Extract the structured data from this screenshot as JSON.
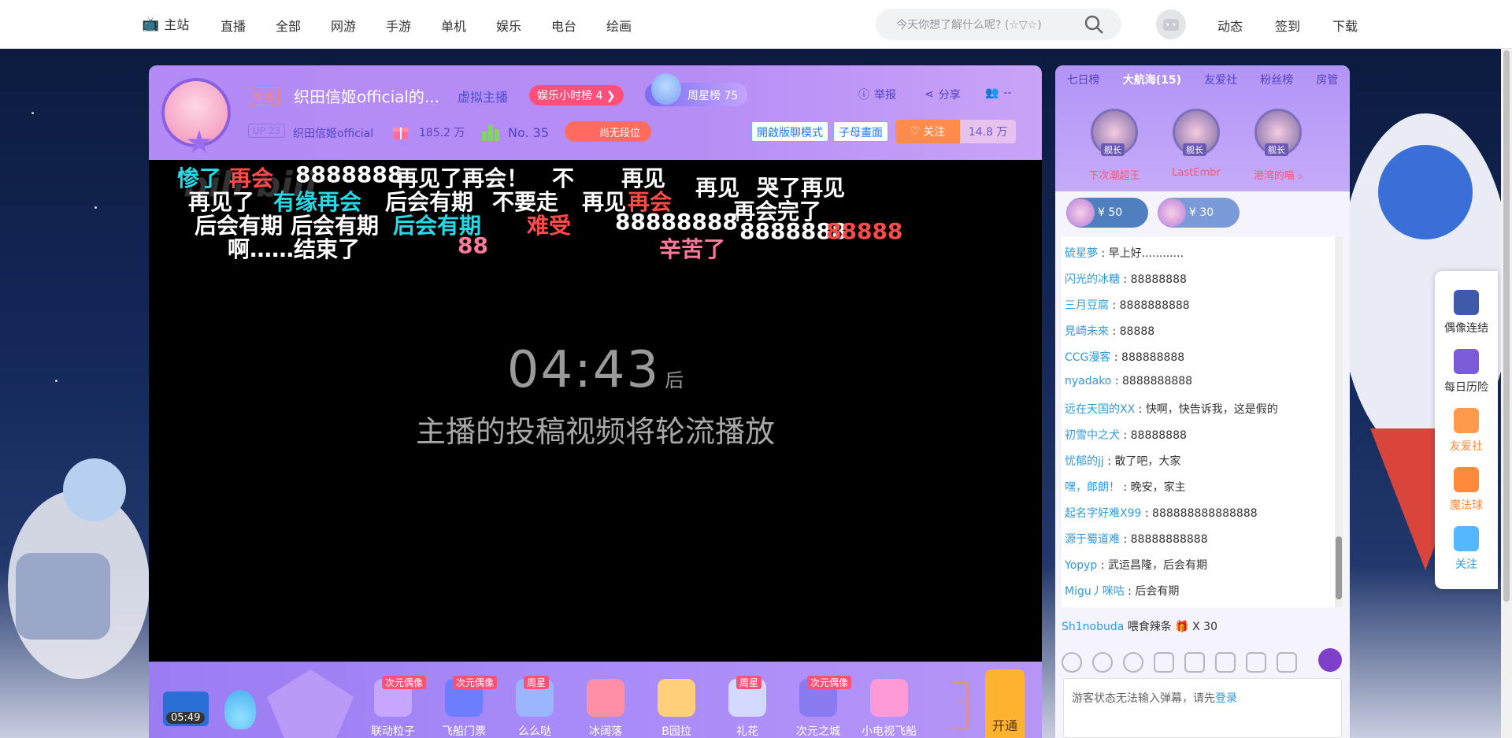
{
  "nav": {
    "home": "主站",
    "links": [
      "直播",
      "全部",
      "网游",
      "手游",
      "单机",
      "娱乐",
      "电台",
      "绘画"
    ],
    "search_placeholder": "今天你想了解什么呢? (☆▽☆)",
    "right_links": [
      "动态",
      "签到",
      "下载"
    ]
  },
  "room": {
    "live_badge": "轮播",
    "title": "织田信姬official的...",
    "category": "虚拟主播",
    "hour_rank": "娱乐小时榜 4",
    "week_rank": "周星榜 75",
    "report": "举报",
    "share": "分享",
    "viewers": "--",
    "up_level": "UP 23",
    "up_name": "织田信姬official",
    "gifts": "185.2 万",
    "rank_no": "No. 35",
    "duan": "尚无段位",
    "btn_danmaku_mode": "開啟版聊模式",
    "btn_pip": "子母畫面",
    "follow": "关注",
    "followers": "14.8 万"
  },
  "player": {
    "watermark": "bili bili",
    "countdown": "04:43",
    "countdown_suffix": "后",
    "message": "主播的投稿视频将轮流播放",
    "danmaku": [
      {
        "text": "惨了",
        "c": "cy"
      },
      {
        "text": "再会",
        "c": "rd"
      },
      {
        "text": "8888888",
        "c": "w"
      },
      {
        "text": "再见了再会！",
        "c": "w"
      },
      {
        "text": "不",
        "c": "w"
      },
      {
        "text": "再见",
        "c": "w"
      },
      {
        "text": "再见",
        "c": "w"
      },
      {
        "text": "哭了再见",
        "c": "w"
      },
      {
        "text": "再见了",
        "c": "w"
      },
      {
        "text": "有缘再会",
        "c": "cy"
      },
      {
        "text": "后会有期",
        "c": "w"
      },
      {
        "text": "不要走",
        "c": "w"
      },
      {
        "text": "再见",
        "c": "w"
      },
      {
        "text": "再会",
        "c": "rd"
      },
      {
        "text": "再会完了",
        "c": "w"
      },
      {
        "text": "后会有期",
        "c": "w"
      },
      {
        "text": "后会有期",
        "c": "w"
      },
      {
        "text": "后会有期",
        "c": "cy"
      },
      {
        "text": "难受",
        "c": "rd"
      },
      {
        "text": "88888888",
        "c": "w"
      },
      {
        "text": "8888888",
        "c": "w"
      },
      {
        "text": "88888",
        "c": "rd"
      },
      {
        "text": "啊……结束了",
        "c": "w"
      },
      {
        "text": "88",
        "c": "pk"
      },
      {
        "text": "辛苦了",
        "c": "pk"
      }
    ]
  },
  "giftbar": {
    "time": "05:49",
    "items": [
      {
        "name": "联动粒子",
        "tag": "次元偶像"
      },
      {
        "name": "飞船门票",
        "tag": "次元偶像"
      },
      {
        "name": "么么哒",
        "tag": "周星"
      },
      {
        "name": "冰阔落",
        "tag": ""
      },
      {
        "name": "B园拉",
        "tag": ""
      },
      {
        "name": "礼花",
        "tag": "周星"
      },
      {
        "name": "次元之城",
        "tag": "次元偶像"
      },
      {
        "name": "小电视飞船",
        "tag": ""
      }
    ],
    "open_label": "开通"
  },
  "side": {
    "tabs": [
      "七日榜",
      "大航海(15)",
      "友爱社",
      "粉丝榜",
      "房管"
    ],
    "guards": [
      {
        "name": "下次潮超王",
        "label": "舰长"
      },
      {
        "name": "LastEmbr",
        "label": "舰长"
      },
      {
        "name": "港湾的喵 ♭",
        "label": "舰长"
      }
    ],
    "coins": [
      "¥ 50",
      "¥ 30"
    ],
    "chat": [
      {
        "u": "硫星夢",
        "m": "早上好............"
      },
      {
        "u": "闪光的冰糖",
        "m": "88888888"
      },
      {
        "u": "三月豆腐",
        "m": "8888888888"
      },
      {
        "u": "見崎未來",
        "m": "88888"
      },
      {
        "u": "CCG漫客",
        "m": "888888888"
      },
      {
        "u": "nyadako",
        "m": "8888888888"
      },
      {
        "u": "远在天国的XX",
        "m": "快啊，快告诉我，这是假的"
      },
      {
        "u": "初雪中之犬",
        "m": "88888888"
      },
      {
        "u": "忧郁的jj",
        "m": "散了吧，大家"
      },
      {
        "u": "嘿，郎朗！",
        "m": "晚安，家主"
      },
      {
        "u": "起名字好难X99",
        "m": "888888888888888"
      },
      {
        "u": "源于蜀道难",
        "m": "88888888888"
      },
      {
        "u": "Yopyp",
        "m": "武运昌隆，后会有期"
      },
      {
        "u": "Migu丿咪咕",
        "m": "后会有期"
      }
    ],
    "gift_msg_user": "Sh1nobuda",
    "gift_msg_text": "喂食辣条",
    "gift_msg_count": "X 30",
    "input_text": "游客状态无法输入弹幕，请先",
    "input_login": "登录"
  },
  "quick": [
    {
      "label": "偶像连结",
      "color": "#333"
    },
    {
      "label": "每日历险",
      "color": "#333"
    },
    {
      "label": "友爱社",
      "color": "#ff8a3c"
    },
    {
      "label": "魔法球",
      "color": "#ff8a3c"
    },
    {
      "label": "关注",
      "color": "#2f9ae0"
    }
  ]
}
